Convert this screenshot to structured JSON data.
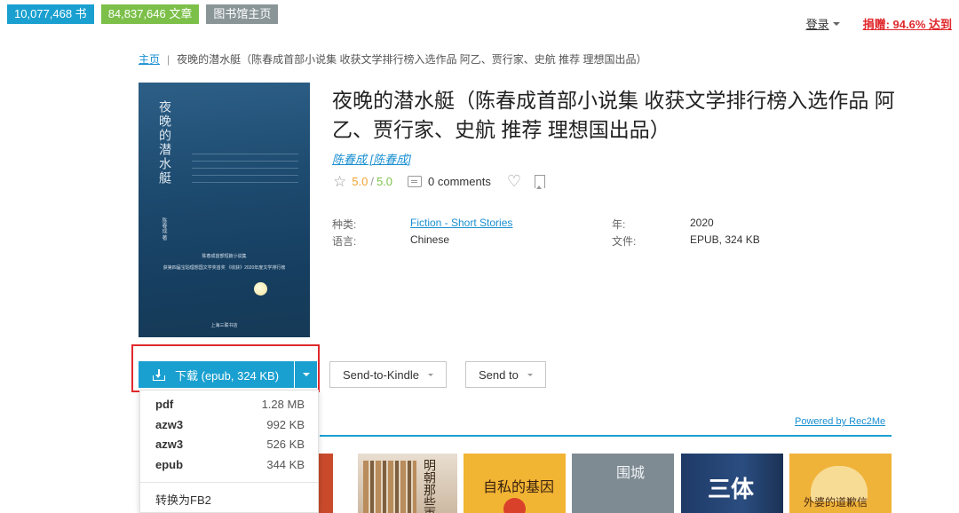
{
  "topbar": {
    "book_count": "10,077,468 书",
    "article_count": "84,837,646 文章",
    "library_home": "图书馆主页",
    "login": "登录",
    "donate": "捐赠: 94.6% 达到"
  },
  "breadcrumb": {
    "home": "主页",
    "separator": "|",
    "current": "夜晚的潜水艇（陈春成首部小说集 收获文学排行榜入选作品 阿乙、贾行家、史航 推荐 理想国出品）"
  },
  "cover": {
    "title": "夜晚的潜水艇",
    "author": "陈春成 著",
    "subtitle_lines": [
      "陈春成首部短篇小说集",
      "获第四届宝珀理想国文学奖首奖 《收获》2020年度文学排行榜"
    ],
    "publisher": "上海三联书店"
  },
  "book": {
    "title": "夜晚的潜水艇（陈春成首部小说集 收获文学排行榜入选作品 阿乙、贾行家、史航 推荐 理想国出品）",
    "author": "陈春成 [陈春成]",
    "rating": "5.0",
    "rating_total": "5.0",
    "comments": "0 comments",
    "props": {
      "category_label": "种类:",
      "category_value": "Fiction - Short Stories",
      "language_label": "语言:",
      "language_value": "Chinese",
      "year_label": "年:",
      "year_value": "2020",
      "file_label": "文件:",
      "file_value": "EPUB, 324 KB"
    }
  },
  "actions": {
    "download": "下载 (epub, 324 KB)",
    "send_kindle": "Send-to-Kindle",
    "send_to": "Send to"
  },
  "dropdown": {
    "items": [
      {
        "format": "pdf",
        "size": "1.28 MB"
      },
      {
        "format": "azw3",
        "size": "992 KB"
      },
      {
        "format": "azw3",
        "size": "526 KB"
      },
      {
        "format": "epub",
        "size": "344 KB"
      }
    ],
    "convert": "转换为FB2"
  },
  "recommendations": {
    "powered_by": "Powered by Rec2Me",
    "books": [
      {
        "title": "明朝那些事儿"
      },
      {
        "title": "自私的基因"
      },
      {
        "title": "围城"
      },
      {
        "title": "三体"
      },
      {
        "title": "外婆的道歉信"
      }
    ]
  },
  "colors": {
    "accent": "#1aa0d0",
    "green": "#7cc04a",
    "donate_red": "#e0292d",
    "rating_orange": "#f0a22e"
  }
}
